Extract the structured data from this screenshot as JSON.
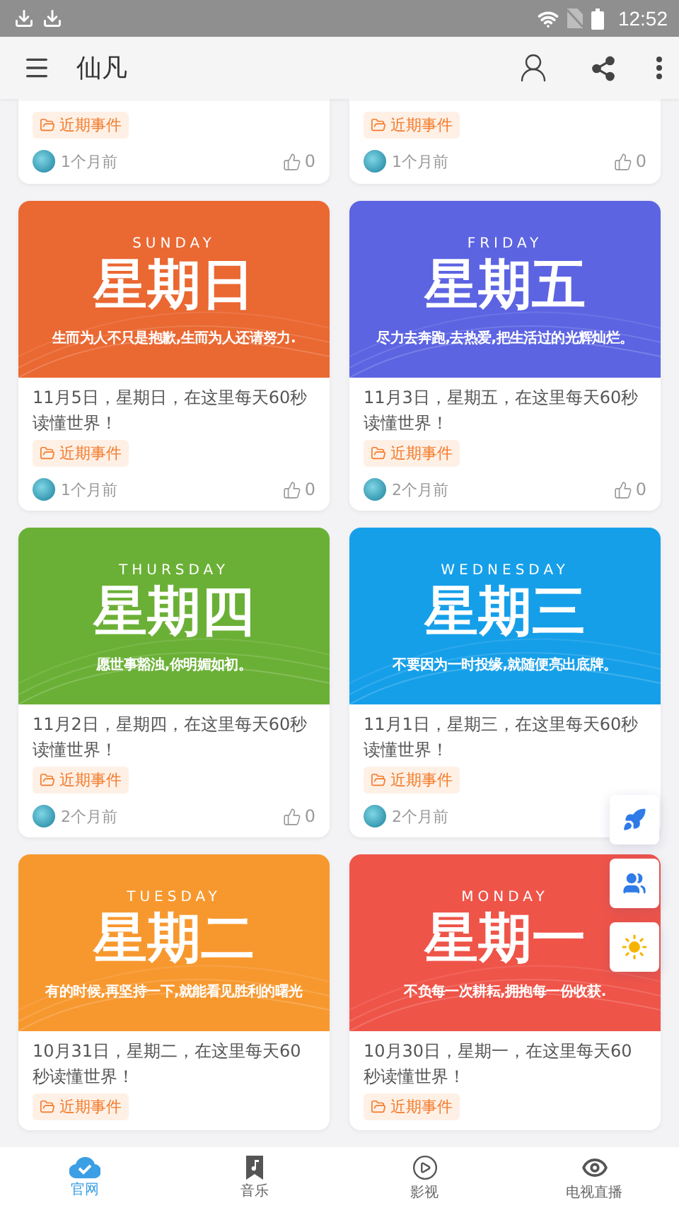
{
  "status_bar": {
    "time": "12:52"
  },
  "app_bar": {
    "title": "仙凡"
  },
  "top_cards": [
    {
      "tag": "近期事件",
      "time": "1个月前",
      "likes": "0"
    },
    {
      "tag": "近期事件",
      "time": "1个月前",
      "likes": "0"
    }
  ],
  "cards": [
    {
      "cover": {
        "color": "#ea6832",
        "day_en": "SUNDAY",
        "day_cn": "星期日",
        "slogan": "生而为人不只是抱歉,生而为人还请努力."
      },
      "title": "11月5日，星期日，在这里每天60秒读懂世界！",
      "tag": "近期事件",
      "time": "1个月前",
      "likes": "0"
    },
    {
      "cover": {
        "color": "#5c64e2",
        "day_en": "FRIDAY",
        "day_cn": "星期五",
        "slogan": "尽力去奔跑,去热爱,把生活过的光辉灿烂。"
      },
      "title": "11月3日，星期五，在这里每天60秒读懂世界！",
      "tag": "近期事件",
      "time": "2个月前",
      "likes": "0"
    },
    {
      "cover": {
        "color": "#6bb036",
        "day_en": "THURSDAY",
        "day_cn": "星期四",
        "slogan": "愿世事豁浊,你明媚如初。"
      },
      "title": "11月2日，星期四，在这里每天60秒读懂世界！",
      "tag": "近期事件",
      "time": "2个月前",
      "likes": "0"
    },
    {
      "cover": {
        "color": "#169fe9",
        "day_en": "WEDNESDAY",
        "day_cn": "星期三",
        "slogan": "不要因为一时投缘,就随便亮出底牌。"
      },
      "title": "11月1日，星期三，在这里每天60秒读懂世界！",
      "tag": "近期事件",
      "time": "2个月前"
    },
    {
      "cover": {
        "color": "#f7982f",
        "day_en": "TUESDAY",
        "day_cn": "星期二",
        "slogan": "有的时候,再坚持一下,就能看见胜利的曙光"
      },
      "title": "10月31日，星期二，在这里每天60秒读懂世界！",
      "tag": "近期事件"
    },
    {
      "cover": {
        "color": "#ef5449",
        "day_en": "MONDAY",
        "day_cn": "星期一",
        "slogan": "不负每一次耕耘,拥抱每一份收获."
      },
      "title": "10月30日，星期一，在这里每天60秒读懂世界！",
      "tag": "近期事件"
    }
  ],
  "floating_buttons": [
    {
      "kind": "rocket"
    },
    {
      "kind": "users"
    },
    {
      "kind": "sun"
    }
  ],
  "bottom_nav": [
    {
      "kind": "cloud",
      "label": "官网",
      "selected": true
    },
    {
      "kind": "music",
      "label": "音乐",
      "selected": false
    },
    {
      "kind": "play",
      "label": "影视",
      "selected": false
    },
    {
      "kind": "eye",
      "label": "电视直播",
      "selected": false
    }
  ]
}
